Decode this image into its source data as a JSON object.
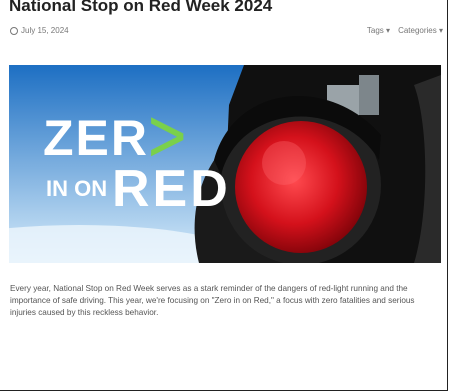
{
  "article": {
    "title": "National Stop on Red Week 2024",
    "date": "July 15, 2024",
    "tags_label": "Tags",
    "categories_label": "Categories",
    "body": "Every year, National Stop on Red Week serves as a stark reminder of the dangers of red-light running and the importance of safe driving. This year, we're focusing on \"Zero in on Red,\" a focus with zero fatalities and serious injuries caused by this reckless behavior."
  },
  "hero": {
    "zero_word": "ZER",
    "arrow": "ᐳ",
    "in_on": "IN ON",
    "red_word": "RED",
    "colors": {
      "sky_top": "#1d6fc3",
      "sky_bottom": "#cfe6f7",
      "red_light": "#d4111b",
      "accent": "#7ad04b"
    }
  }
}
